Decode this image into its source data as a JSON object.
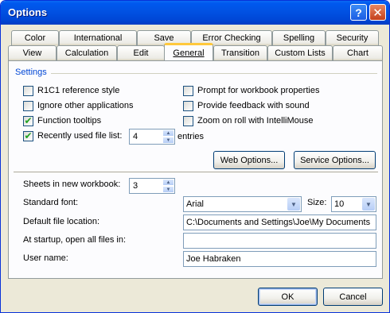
{
  "window": {
    "title": "Options",
    "help_icon": "?",
    "close_icon": "✕"
  },
  "tabs_back": [
    "Color",
    "International",
    "Save",
    "Error Checking",
    "Spelling",
    "Security"
  ],
  "tabs_front": [
    "View",
    "Calculation",
    "Edit",
    "General",
    "Transition",
    "Custom Lists",
    "Chart"
  ],
  "active_tab": "General",
  "settings": {
    "title": "Settings",
    "r1c1": {
      "label": "R1C1 reference style",
      "checked": false
    },
    "ignore_apps": {
      "label": "Ignore other applications",
      "checked": false
    },
    "function_tooltips": {
      "label": "Function tooltips",
      "checked": true
    },
    "recent_files": {
      "label": "Recently used file list:",
      "checked": true,
      "value": "4",
      "suffix": "entries"
    },
    "prompt_props": {
      "label": "Prompt for workbook properties",
      "checked": false
    },
    "feedback_sound": {
      "label": "Provide feedback with sound",
      "checked": false
    },
    "zoom_roll": {
      "label": "Zoom on roll with IntelliMouse",
      "checked": false
    },
    "check_mark": "✔",
    "web_options": "Web Options...",
    "service_options": "Service Options..."
  },
  "workbook": {
    "sheets_label": "Sheets in new workbook:",
    "sheets_value": "3",
    "font_label": "Standard font:",
    "font_value": "Arial",
    "size_label": "Size:",
    "size_value": "10",
    "file_location_label": "Default file location:",
    "file_location_value": "C:\\Documents and Settings\\Joe\\My Documents",
    "startup_label": "At startup, open all files in:",
    "startup_value": "",
    "username_label": "User name:",
    "username_value": "Joe Habraken"
  },
  "footer": {
    "ok": "OK",
    "cancel": "Cancel"
  },
  "arrows": {
    "up": "▲",
    "down": "▼"
  }
}
